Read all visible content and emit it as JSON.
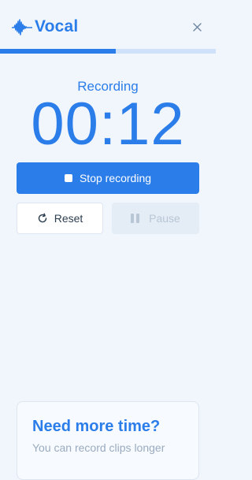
{
  "header": {
    "logo_text": "Vocal",
    "logo_icon": "waveform-icon",
    "close_icon": "close-icon"
  },
  "progress": {
    "fraction": 0.535
  },
  "recorder": {
    "status": "Recording",
    "timer": "00:12",
    "stop_label": "Stop recording",
    "reset_label": "Reset",
    "pause_label": "Pause"
  },
  "upsell": {
    "title": "Need more time?",
    "text": "You can record clips longer"
  },
  "colors": {
    "accent": "#2b7de9",
    "background": "#f1f6fd",
    "disabled": "#e4ecf5"
  }
}
